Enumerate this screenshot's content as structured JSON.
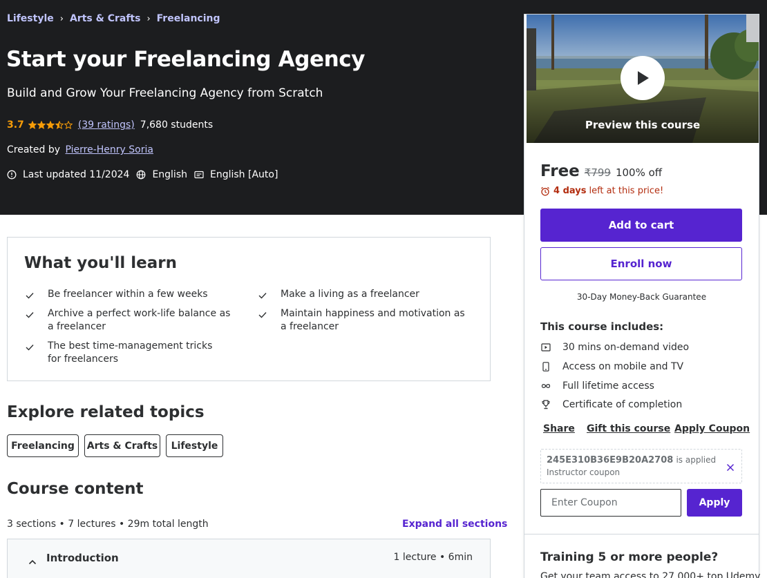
{
  "hero": {
    "breadcrumb": [
      "Lifestyle",
      "Arts & Crafts",
      "Freelancing"
    ],
    "title": "Start your Freelancing Agency",
    "subtitle": "Build and Grow Your Freelancing Agency from Scratch",
    "rating": "3.7",
    "stars": [
      1,
      1,
      1,
      0.5,
      0
    ],
    "ratings_count": "(39 ratings)",
    "students": "7,680 students",
    "created_by_label": "Created by",
    "author": "Pierre-Henry Soria",
    "last_updated": "Last updated 11/2024",
    "language": "English",
    "captions": "English [Auto]"
  },
  "learn": {
    "title": "What you'll learn",
    "items": [
      "Be freelancer within a few weeks",
      "Make a living as a freelancer",
      "Archive a perfect work-life balance as a freelancer",
      "Maintain happiness and motivation as a freelancer",
      "The best time-management tricks for freelancers"
    ]
  },
  "related": {
    "title": "Explore related topics",
    "topics": [
      "Freelancing",
      "Arts & Crafts",
      "Lifestyle"
    ]
  },
  "course_content": {
    "title": "Course content",
    "summary": "3 sections • 7 lectures • 29m total length",
    "expand_all": "Expand all sections",
    "sections": [
      {
        "title": "Introduction",
        "meta": "1 lecture • 6min"
      }
    ]
  },
  "sidebar": {
    "preview_label": "Preview this course",
    "price_free": "Free",
    "price_original": "₹799",
    "discount": "100% off",
    "timer_days": "4 days",
    "timer_text": "left at this price!",
    "add_to_cart": "Add to cart",
    "enroll_now": "Enroll now",
    "guarantee": "30-Day Money-Back Guarantee",
    "includes_title": "This course includes:",
    "includes": [
      {
        "icon": "video-icon",
        "label": "30 mins on-demand video"
      },
      {
        "icon": "mobile-icon",
        "label": "Access on mobile and TV"
      },
      {
        "icon": "infinity-icon",
        "label": "Full lifetime access"
      },
      {
        "icon": "trophy-icon",
        "label": "Certificate of completion"
      }
    ],
    "share": "Share",
    "gift": "Gift this course",
    "apply_coupon": "Apply Coupon",
    "coupon_code": "245E310B36E9B20A2708",
    "coupon_applied": "is applied",
    "coupon_type": "Instructor coupon",
    "coupon_placeholder": "Enter Coupon",
    "apply": "Apply",
    "training_title": "Training 5 or more people?",
    "training_sub": "Get your team access to 27,000+ top Udemy"
  },
  "colors": {
    "hero_bg": "#1c1d1f",
    "link_purple_light": "#c0c4fc",
    "primary_purple": "#5624d0",
    "rating_orange": "#f69c08",
    "timer_red": "#b32d0f"
  }
}
